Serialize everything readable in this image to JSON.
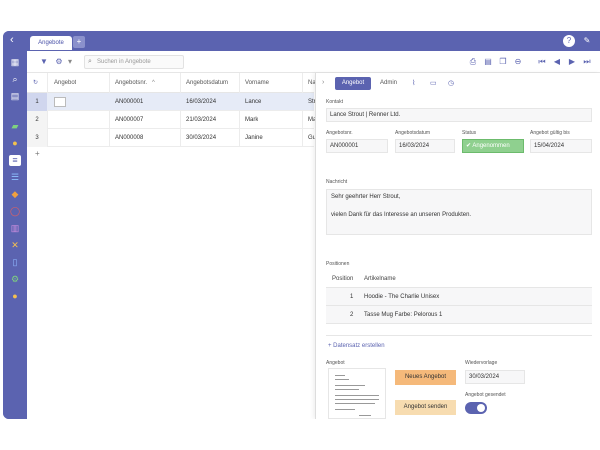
{
  "window": {
    "back_icon": "chevron-left-icon",
    "tab_label": "Angebote",
    "tab_add": "+"
  },
  "toolbar": {
    "search_placeholder": "Suchen in Angebote"
  },
  "grid": {
    "columns": [
      "Angebot",
      "Angebotsnr.",
      "Angebotsdatum",
      "Vorname",
      "Na"
    ],
    "sort_indicator": "^",
    "rows": [
      {
        "num": "1",
        "nr": "AN000001",
        "date": "16/03/2024",
        "first": "Lance",
        "last": "Str",
        "selected": true
      },
      {
        "num": "2",
        "nr": "AN000007",
        "date": "21/03/2024",
        "first": "Mark",
        "last": "Ma"
      },
      {
        "num": "3",
        "nr": "AN000008",
        "date": "30/03/2024",
        "first": "Janine",
        "last": "Gu"
      }
    ],
    "add": "+"
  },
  "panel": {
    "tabs": [
      "Angebot",
      "Admin"
    ],
    "kontakt_label": "Kontakt",
    "kontakt_value": "Lance Strout | Renner Ltd.",
    "angebotsnr_label": "Angebotsnr.",
    "angebotsnr_value": "AN000001",
    "angebotsdatum_label": "Angebotsdatum",
    "angebotsdatum_value": "16/03/2024",
    "status_label": "Status",
    "status_value": "Angenommen",
    "gueltig_label": "Angebot gültig bis",
    "gueltig_value": "15/04/2024",
    "nachricht_label": "Nachricht",
    "nachricht_line1": "Sehr geehrter Herr Strout,",
    "nachricht_line2": "vielen Dank für das Interesse an unseren Produkten.",
    "positionen_label": "Positionen",
    "pos_col1": "Position",
    "pos_col2": "Artikelname",
    "positions": [
      {
        "pos": "1",
        "name": "Hoodie - The Charlie Unisex"
      },
      {
        "pos": "2",
        "name": "Tasse Mug Farbe: Pelorous 1"
      }
    ],
    "create_label": "Datensatz erstellen",
    "angebot_label": "Angebot",
    "neues_angebot": "Neues Angebot",
    "angebot_senden": "Angebot senden",
    "wiedervorlage_label": "Wiedervorlage",
    "wiedervorlage_value": "30/03/2024",
    "gesendet_label": "Angebot gesendet",
    "gesendet": true
  },
  "colors": {
    "accent": "#5b63b0",
    "status_green": "#8fd08f",
    "button_orange": "#f5b97a"
  }
}
